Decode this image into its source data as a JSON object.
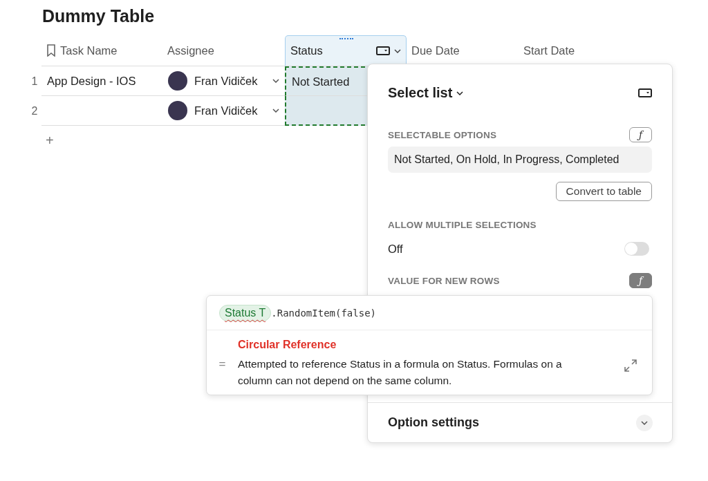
{
  "title": "Dummy Table",
  "table": {
    "columns": [
      {
        "label": "Task Name",
        "kind": "text",
        "selected": false
      },
      {
        "label": "Assignee",
        "kind": "person",
        "selected": false
      },
      {
        "label": "Status",
        "kind": "select",
        "selected": true
      },
      {
        "label": "Due Date",
        "kind": "date",
        "selected": false
      },
      {
        "label": "Start Date",
        "kind": "date",
        "selected": false
      }
    ],
    "rows": [
      {
        "number": "1",
        "task_name": "App Design - IOS",
        "assignee": "Fran Vidiček",
        "status": "Not Started"
      },
      {
        "number": "2",
        "assignee": "Fran Vidiček"
      }
    ],
    "add_row": "+"
  },
  "panel": {
    "title": "Select list",
    "selectable_options": {
      "label": "SELECTABLE OPTIONS",
      "formula": {
        "glyph": "ƒ",
        "on": false
      },
      "value": "Not Started, On Hold, In Progress, Completed"
    },
    "convert_button": "Convert to table",
    "allow_multiple": {
      "label": "ALLOW MULTIPLE SELECTIONS",
      "state_text": "Off",
      "on": false
    },
    "value_for_new_rows": {
      "label": "VALUE FOR NEW ROWS",
      "formula": {
        "glyph": "ƒ",
        "on": true
      }
    },
    "option_settings": {
      "label": "Option settings",
      "expanded": false
    }
  },
  "formula_popup": {
    "chip": {
      "label": "Status",
      "type_glyph": "T"
    },
    "expression": ".RandomItem(false)",
    "result_glyph": "=",
    "error_title": "Circular Reference",
    "error_message": "Attempted to reference Status in a formula on Status. Formulas on a column can not depend on the same column."
  }
}
